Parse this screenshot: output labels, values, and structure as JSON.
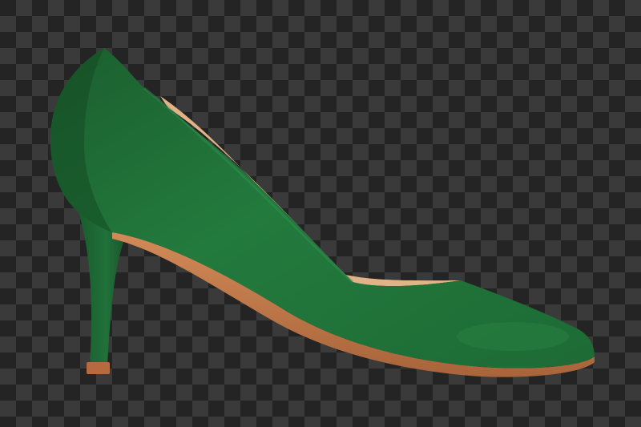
{
  "image": {
    "subject": "green-suede-pointed-toe-pump",
    "background": "transparency-checkerboard",
    "colors": {
      "suede": "#1f6b35",
      "suede_dark": "#12461f",
      "suede_light": "#2b8543",
      "sole": "#c27a4a",
      "lining": "#e6b98e",
      "checker_dark": "#242424",
      "checker_light": "#3a3a3a"
    }
  }
}
